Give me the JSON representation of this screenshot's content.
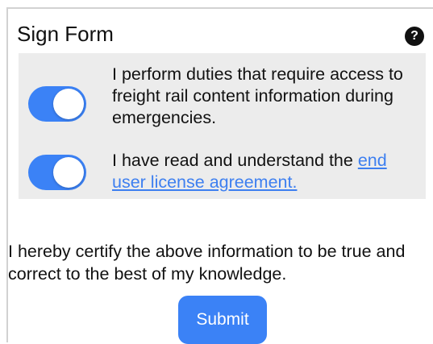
{
  "form": {
    "title": "Sign Form",
    "help_icon_glyph": "?",
    "help_icon": "help-icon"
  },
  "agreements": [
    {
      "text": "I perform duties that require access to freight rail content information during emergencies.",
      "toggle_on": true
    },
    {
      "text_before_link": "I have read and understand the ",
      "link_text": "end user license agreement.",
      "toggle_on": true
    }
  ],
  "certification": {
    "text": "I hereby certify the above information to be true and correct to the best of my knowledge."
  },
  "submit": {
    "label": "Submit"
  },
  "colors": {
    "accent": "#3b82f6",
    "link": "#3d7ff0",
    "panel_background": "#ececec"
  }
}
